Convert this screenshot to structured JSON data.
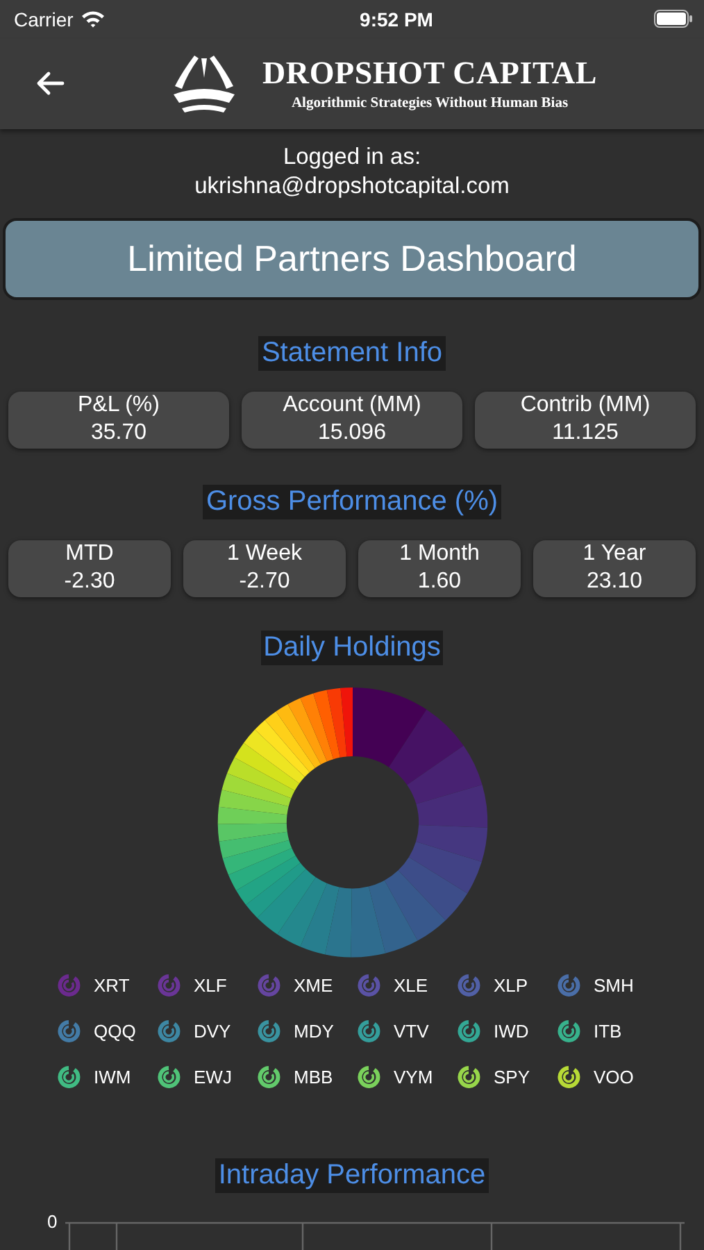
{
  "status_bar": {
    "carrier": "Carrier",
    "time": "9:52 PM"
  },
  "header": {
    "title": "DROPSHOT CAPITAL",
    "subtitle": "Algorithmic Strategies Without Human Bias"
  },
  "login": {
    "label": "Logged in as:",
    "email": "ukrishna@dropshotcapital.com"
  },
  "banner": "Limited Partners Dashboard",
  "statement": {
    "heading": "Statement Info",
    "cards": [
      {
        "label": "P&L (%)",
        "value": "35.70"
      },
      {
        "label": "Account (MM)",
        "value": "15.096"
      },
      {
        "label": "Contrib (MM)",
        "value": "11.125"
      }
    ]
  },
  "performance": {
    "heading": "Gross Performance (%)",
    "cards": [
      {
        "label": "MTD",
        "value": "-2.30"
      },
      {
        "label": "1 Week",
        "value": "-2.70"
      },
      {
        "label": "1 Month",
        "value": "1.60"
      },
      {
        "label": "1 Year",
        "value": "23.10"
      }
    ]
  },
  "holdings": {
    "heading": "Daily Holdings",
    "legend": [
      {
        "label": "XRT",
        "color": "#6b2a8e"
      },
      {
        "label": "XLF",
        "color": "#6a3597"
      },
      {
        "label": "XME",
        "color": "#6545a0"
      },
      {
        "label": "XLE",
        "color": "#5a52a5"
      },
      {
        "label": "XLP",
        "color": "#5160a6"
      },
      {
        "label": "SMH",
        "color": "#4a6ea8"
      },
      {
        "label": "QQQ",
        "color": "#437ba6"
      },
      {
        "label": "DVY",
        "color": "#3d87a3"
      },
      {
        "label": "MDY",
        "color": "#3993a0"
      },
      {
        "label": "VTV",
        "color": "#349e9b"
      },
      {
        "label": "IWD",
        "color": "#33a895"
      },
      {
        "label": "ITB",
        "color": "#37b28c"
      },
      {
        "label": "IWM",
        "color": "#40bb83"
      },
      {
        "label": "EWJ",
        "color": "#4fc378"
      },
      {
        "label": "MBB",
        "color": "#62ca6b"
      },
      {
        "label": "VYM",
        "color": "#7ad15b"
      },
      {
        "label": "SPY",
        "color": "#97d64a"
      },
      {
        "label": "VOO",
        "color": "#b7da36"
      }
    ]
  },
  "intraday": {
    "heading": "Intraday Performance",
    "y_tick": "0"
  }
}
